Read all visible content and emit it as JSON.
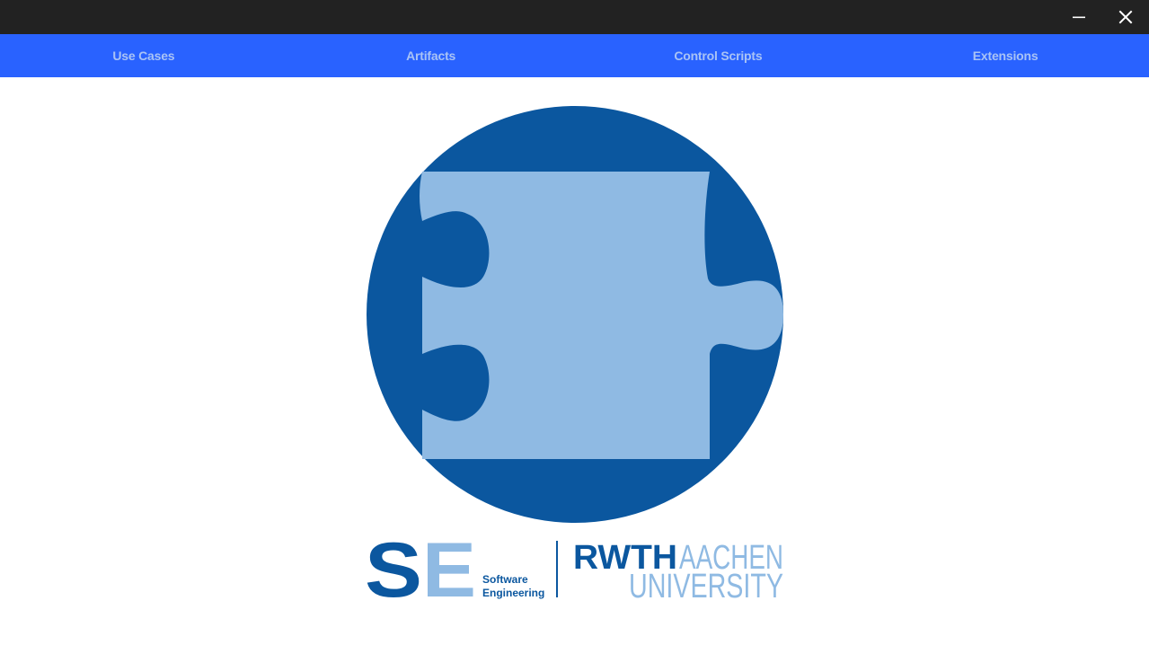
{
  "window": {
    "controls": {
      "minimize_icon": "minimize-icon",
      "close_icon": "close-icon"
    }
  },
  "nav": {
    "tabs": [
      {
        "label": "Use Cases"
      },
      {
        "label": "Artifacts"
      },
      {
        "label": "Control Scripts"
      },
      {
        "label": "Extensions"
      }
    ]
  },
  "logos": {
    "se_mark": "SE",
    "se_line1": "Software",
    "se_line2": "Engineering",
    "rwth_line1_a": "RWTH",
    "rwth_line1_b": "AACHEN",
    "rwth_line2": "UNIVERSITY"
  },
  "colors": {
    "titlebar": "#222222",
    "navbar": "#2962ff",
    "tab_text": "#a9c3f5",
    "emblem_dark": "#0b579f",
    "emblem_light": "#8fbae3"
  }
}
